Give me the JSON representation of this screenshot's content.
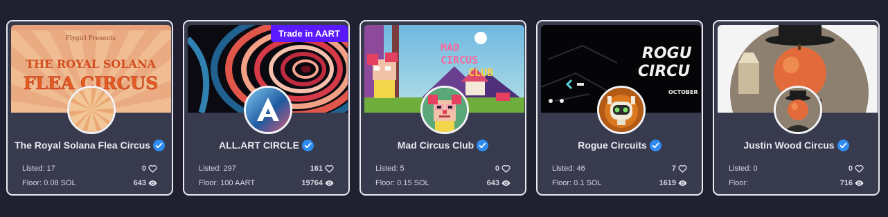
{
  "collections": [
    {
      "name": "The Royal Solana Flea Circus",
      "badge": "",
      "listed": "Listed: 17",
      "floor": "Floor: 0.08 SOL",
      "likes": "0",
      "views": "643",
      "icon": "flea-circus-sunburst",
      "banner_text": [
        "Flygirl Presents",
        "THE ROYAL SOLANA",
        "FLEA CIRCUS"
      ]
    },
    {
      "name": "ALL.ART CIRCLE",
      "badge": "Trade in AART",
      "listed": "Listed: 297",
      "floor": "Floor: 100 AART",
      "likes": "161",
      "views": "19764",
      "icon": "allart-logo"
    },
    {
      "name": "Mad Circus Club",
      "badge": "",
      "listed": "Listed: 5",
      "floor": "Floor: 0.15 SOL",
      "likes": "0",
      "views": "643",
      "icon": "pixel-clown",
      "banner_text": [
        "MAD",
        "CIRCUS",
        "CLUB"
      ]
    },
    {
      "name": "Rogue Circuits",
      "badge": "",
      "listed": "Listed: 46",
      "floor": "Floor: 0.1 SOL",
      "likes": "7",
      "views": "1619",
      "icon": "robot",
      "banner_text": [
        "ROGU",
        "CIRCU",
        "OCTOBER"
      ]
    },
    {
      "name": "Justin Wood Circus",
      "badge": "",
      "listed": "Listed: 0",
      "floor": "Floor:",
      "likes": "0",
      "views": "716",
      "icon": "apple-face-man"
    }
  ],
  "colors": {
    "background": "#202030",
    "card": "#383a4e",
    "card_border": "#e9e9ef",
    "badge": "#5b19ff",
    "verified": "#2e8cf0"
  }
}
